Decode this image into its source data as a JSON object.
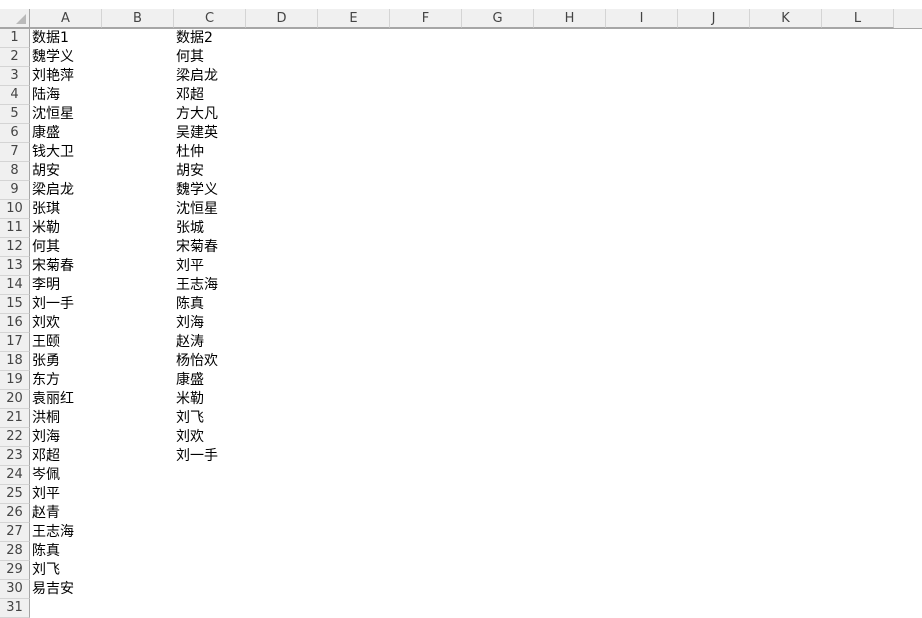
{
  "columns": [
    "A",
    "B",
    "C",
    "D",
    "E",
    "F",
    "G",
    "H",
    "I",
    "J",
    "K",
    "L"
  ],
  "row_numbers": [
    "1",
    "2",
    "3",
    "4",
    "5",
    "6",
    "7",
    "8",
    "9",
    "10",
    "11",
    "12",
    "13",
    "14",
    "15",
    "16",
    "17",
    "18",
    "19",
    "20",
    "21",
    "22",
    "23",
    "24",
    "25",
    "26",
    "27",
    "28",
    "29",
    "30",
    "31"
  ],
  "column_a": [
    "数据1",
    "魏学义",
    "刘艳萍",
    "陆海",
    "沈恒星",
    "康盛",
    "钱大卫",
    "胡安",
    "梁启龙",
    "张琪",
    "米勒",
    "何其",
    "宋菊春",
    "李明",
    "刘一手",
    "刘欢",
    "王颐",
    "张勇",
    "东方",
    "袁丽红",
    "洪桐",
    "刘海",
    "邓超",
    "岑佩",
    "刘平",
    "赵青",
    "王志海",
    "陈真",
    "刘飞",
    "易吉安"
  ],
  "column_c": [
    "数据2",
    "何其",
    "梁启龙",
    "邓超",
    "方大凡",
    "吴建英",
    "杜仲",
    "胡安",
    "魏学义",
    "沈恒星",
    "张城",
    "宋菊春",
    "刘平",
    "王志海",
    "陈真",
    "刘海",
    "赵涛",
    "杨怡欢",
    "康盛",
    "米勒",
    "刘飞",
    "刘欢",
    "刘一手"
  ]
}
